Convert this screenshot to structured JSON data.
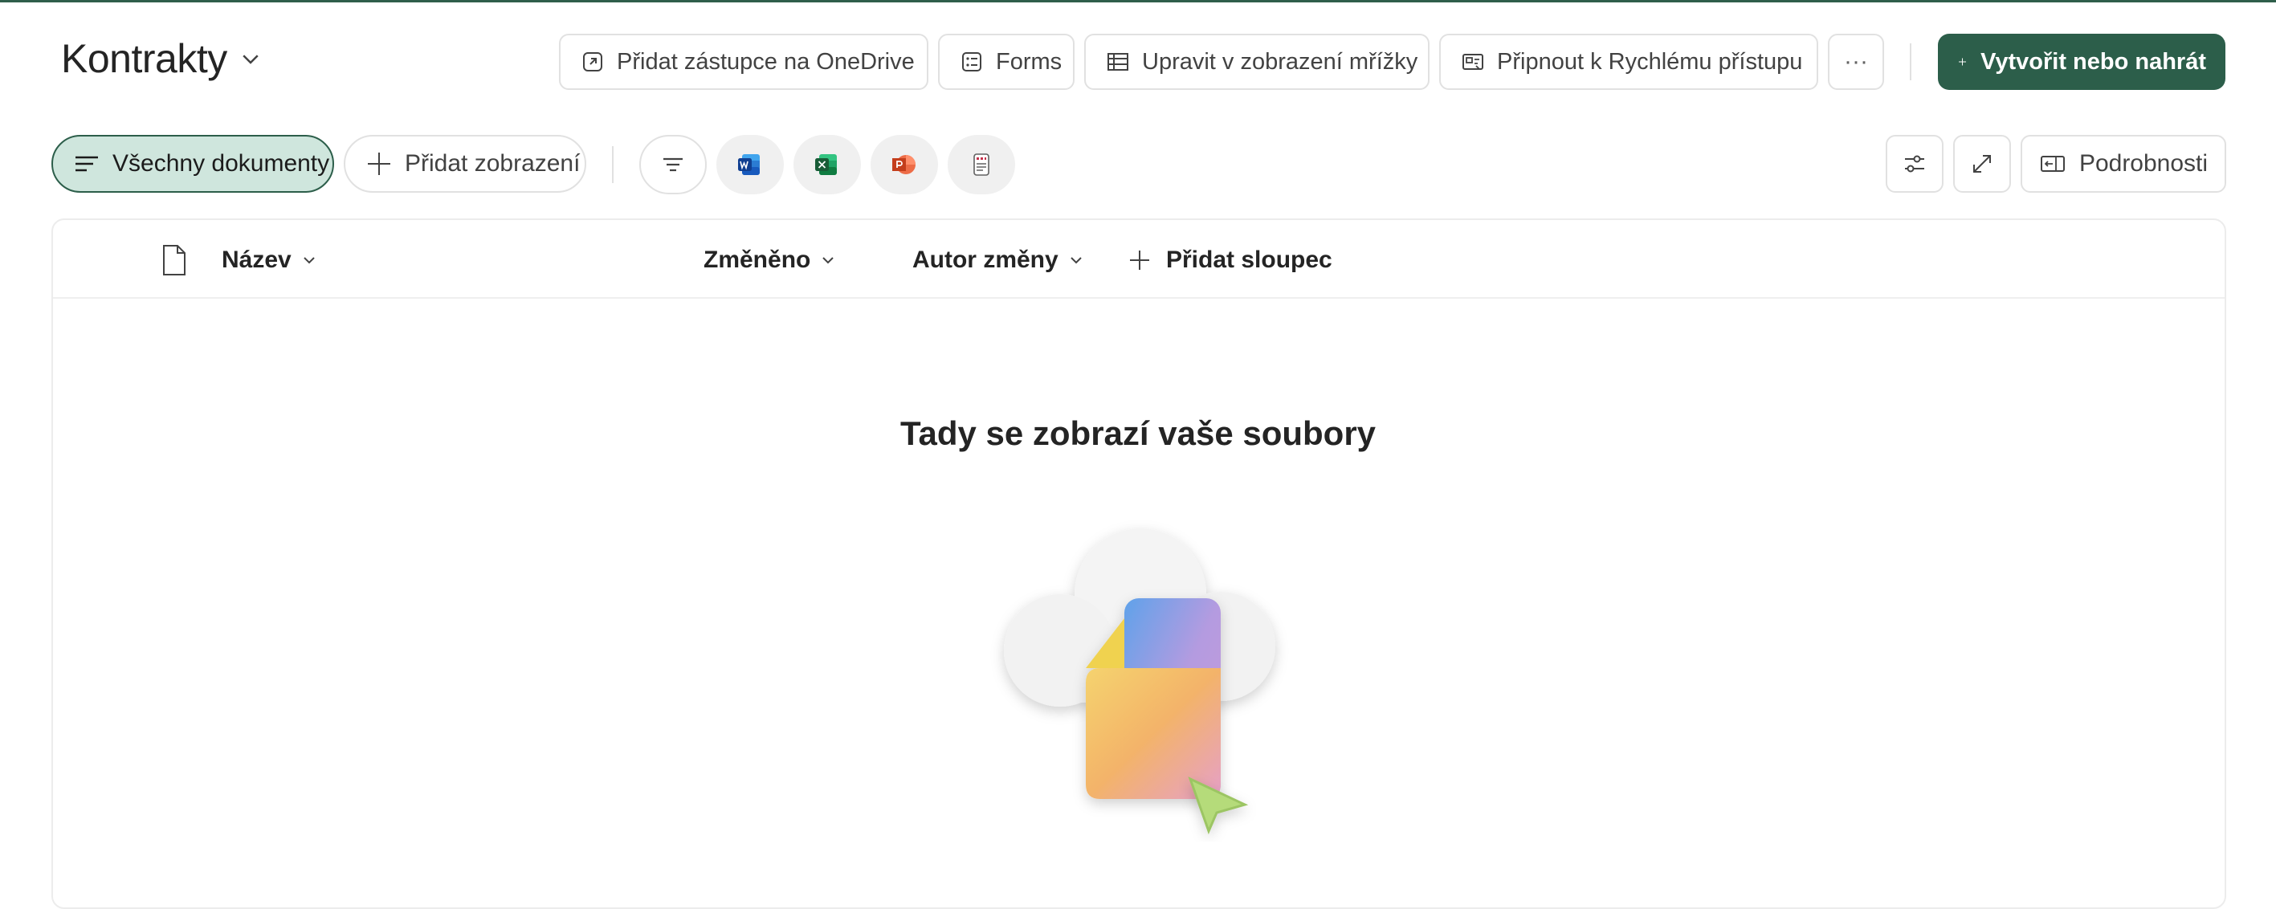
{
  "library": {
    "title": "Kontrakty"
  },
  "toolbar": {
    "add_shortcut": "Přidat zástupce na OneDrive",
    "forms": "Forms",
    "edit_grid": "Upravit v zobrazení mřížky",
    "pin_quick_access": "Připnout k Rychlému přístupu",
    "more": "···",
    "create_upload": "Vytvořit nebo nahrát"
  },
  "views": {
    "active_view": "Všechny dokumenty",
    "add_view": "Přidat zobrazení",
    "details": "Podrobnosti"
  },
  "quick_create": {
    "word_icon": "word-icon",
    "excel_icon": "excel-icon",
    "powerpoint_icon": "powerpoint-icon",
    "forms_icon": "forms-list-icon"
  },
  "columns": {
    "name": "Název",
    "modified": "Změněno",
    "modified_by": "Autor změny",
    "add_column": "Přidat sloupec"
  },
  "empty_state": {
    "title": "Tady se zobrazí vaše soubory"
  },
  "colors": {
    "accent": "#2c5e4a",
    "accent_light": "#cfe6dd"
  }
}
